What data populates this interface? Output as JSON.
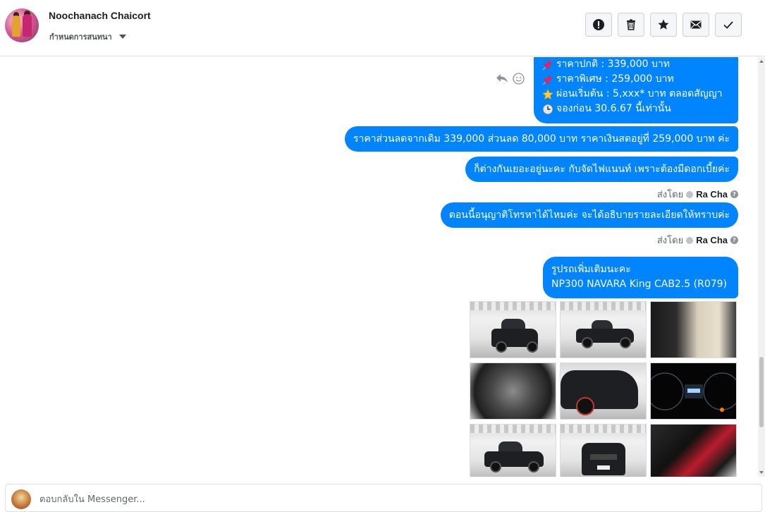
{
  "header": {
    "contact_name": "Noochanach Chaicort",
    "conversation_settings": "กำหนดการสนทนา",
    "actions": [
      {
        "name": "mark-spam-button",
        "icon": "exclamation-icon"
      },
      {
        "name": "delete-button",
        "icon": "trash-icon"
      },
      {
        "name": "star-button",
        "icon": "star-icon"
      },
      {
        "name": "mark-unread-button",
        "icon": "envelope-icon"
      },
      {
        "name": "mark-done-button",
        "icon": "check-icon"
      }
    ]
  },
  "messages": {
    "price_block": [
      {
        "icon": "pushpin-icon",
        "text": "ราคาปกติ : 339,000 บาท"
      },
      {
        "icon": "pushpin-icon",
        "text": "ราคาพิเศษ : 259,000 บาท"
      },
      {
        "icon": "star-emoji-icon",
        "text": "ผ่อนเริ่มต้น : 5,xxx* บาท ตลอดสัญญา"
      },
      {
        "icon": "clock-icon",
        "text": "จองก่อน 30.6.67 นี้เท่านั้น"
      }
    ],
    "msg2": "ราคาส่วนลดจากเดิม 339,000  ส่วนลด 80,000 บาท ราคาเงินสดอยู่ที่ 259,000 บาท ค่ะ",
    "msg3": "ก็ต่างกันเยอะอยู่นะคะ กับจัดไฟแนนท์ เพราะต้องมีดอกเบี้ยค่ะ",
    "msg4": "ตอนนี้อนุญาติโทรหาได้ไหมค่ะ จะได้อธิบายรายละเอียดให้ทราบค่ะ",
    "msg5_line1": "รูปรถเพิ่มเติมนะคะ",
    "msg5_line2": "NP300 NAVARA King CAB2.5 (R079)"
  },
  "sent_by": {
    "label": "ส่งโดย",
    "sender": "Ra Cha"
  },
  "photos_count": 9,
  "colors": {
    "bubble": "#0084ff",
    "bubble_text": "#ffffff",
    "meta_text": "#606770"
  },
  "reply": {
    "placeholder": "ตอบกลับใน Messenger..."
  }
}
